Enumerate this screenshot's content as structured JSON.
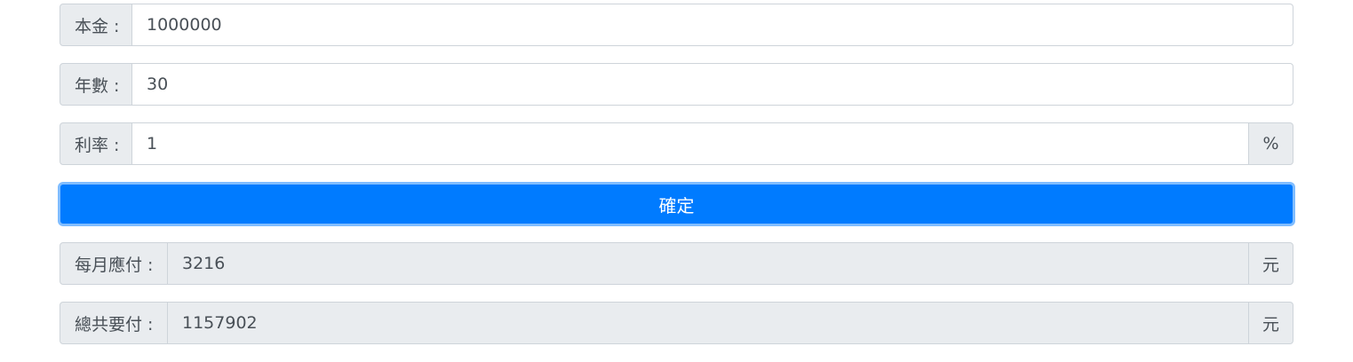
{
  "form": {
    "principal": {
      "label": "本金 :",
      "value": "1000000"
    },
    "years": {
      "label": "年數 :",
      "value": "30"
    },
    "rate": {
      "label": "利率 :",
      "value": "1",
      "unit": "%"
    },
    "confirm_label": "確定",
    "monthly": {
      "label": "每月應付 :",
      "value": "3216",
      "unit": "元"
    },
    "total": {
      "label": "總共要付 :",
      "value": "1157902",
      "unit": "元"
    }
  },
  "colors": {
    "primary": "#007bff",
    "addon_bg": "#e9ecef",
    "border": "#ced4da",
    "text": "#495057"
  }
}
